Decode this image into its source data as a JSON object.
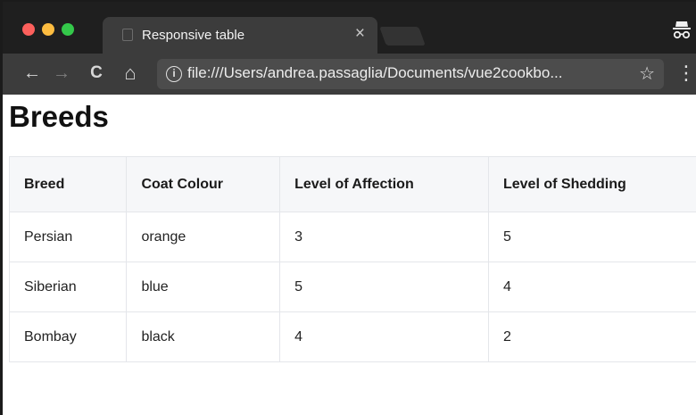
{
  "window": {
    "tab_title": "Responsive table",
    "tab_close_glyph": "×",
    "traffic_lights": [
      "#fc605c",
      "#fdbc40",
      "#34c84a"
    ]
  },
  "toolbar": {
    "back_glyph": "←",
    "forward_glyph": "→",
    "reload_glyph": "C",
    "home_glyph": "⌂",
    "info_glyph": "i",
    "url": "file:///Users/andrea.passaglia/Documents/vue2cookbo...",
    "star_glyph": "☆",
    "menu_glyph": "⋮"
  },
  "page": {
    "title": "Breeds",
    "table": {
      "headers": [
        "Breed",
        "Coat Colour",
        "Level of Affection",
        "Level of Shedding"
      ],
      "rows": [
        [
          "Persian",
          "orange",
          "3",
          "5"
        ],
        [
          "Siberian",
          "blue",
          "5",
          "4"
        ],
        [
          "Bombay",
          "black",
          "4",
          "2"
        ]
      ]
    }
  },
  "icons": {
    "tab_favicon": "document-icon",
    "incognito": "incognito-icon",
    "info": "info-icon",
    "star": "star-icon",
    "menu": "kebab-menu-icon"
  }
}
